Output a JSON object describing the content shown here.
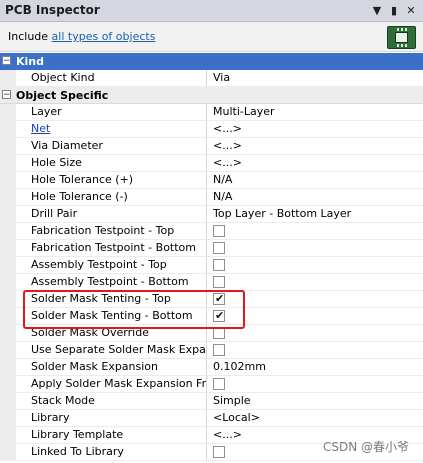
{
  "panel": {
    "title": "PCB Inspector"
  },
  "titlebar": {
    "dropdown_icon": "▼",
    "pin_icon": "▮",
    "close_icon": "✕"
  },
  "include": {
    "prefix": "Include ",
    "link": "all types of objects"
  },
  "categories": {
    "kind": {
      "label": "Kind",
      "toggle": "−"
    },
    "object_specific": {
      "label": "Object Specific",
      "toggle": "−"
    }
  },
  "kind_rows": [
    {
      "name": "Object Kind",
      "value": "Via"
    }
  ],
  "rows": [
    {
      "name": "Layer",
      "value": "Multi-Layer"
    },
    {
      "name": "Net",
      "value": "<...>",
      "link": true
    },
    {
      "name": "Via Diameter",
      "value": "<...>"
    },
    {
      "name": "Hole Size",
      "value": "<...>"
    },
    {
      "name": "Hole Tolerance (+)",
      "value": "N/A"
    },
    {
      "name": "Hole Tolerance (-)",
      "value": "N/A"
    },
    {
      "name": "Drill Pair",
      "value": "Top Layer - Bottom Layer"
    },
    {
      "name": "Fabrication Testpoint - Top",
      "checkbox": false
    },
    {
      "name": "Fabrication Testpoint - Bottom",
      "checkbox": false
    },
    {
      "name": "Assembly Testpoint - Top",
      "checkbox": false
    },
    {
      "name": "Assembly Testpoint - Bottom",
      "checkbox": false
    },
    {
      "name": "Solder Mask Tenting - Top",
      "checkbox": true
    },
    {
      "name": "Solder Mask Tenting - Bottom",
      "checkbox": true
    },
    {
      "name": "Solder Mask Override",
      "checkbox": false
    },
    {
      "name": "Use Separate Solder Mask Expan...",
      "checkbox": false
    },
    {
      "name": "Solder Mask Expansion",
      "value": "0.102mm"
    },
    {
      "name": "Apply Solder Mask Expansion Fr...",
      "checkbox": false
    },
    {
      "name": "Stack Mode",
      "value": "Simple"
    },
    {
      "name": "Library",
      "value": "<Local>"
    },
    {
      "name": "Library Template",
      "value": "<...>"
    },
    {
      "name": "Linked To Library",
      "checkbox": false
    }
  ],
  "check_glyph": "✔",
  "watermark": "CSDN @春小爷",
  "colors": {
    "selection": "#3a70c8",
    "highlight_box": "#e0191b",
    "link": "#1a5fb4"
  }
}
